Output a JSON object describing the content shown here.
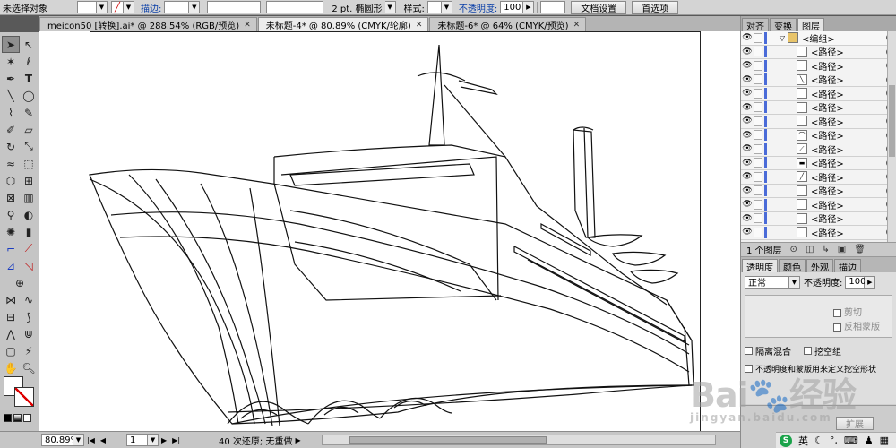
{
  "control_bar": {
    "selection_status": "未选择对象",
    "stroke_label": "描边:",
    "stroke_weight": "2 pt. 椭圆形",
    "style_label": "样式:",
    "opacity_label": "不透明度:",
    "opacity_value": "100",
    "doc_setup_button": "文档设置",
    "preferences_button": "首选项"
  },
  "tabs": [
    {
      "label": "meicon50 [转换].ai* @ 288.54% (RGB/预览)",
      "close": "✕"
    },
    {
      "label": "未标题-4* @ 80.89% (CMYK/轮廓)",
      "close": "✕"
    },
    {
      "label": "未标题-6* @ 64% (CMYK/预览)",
      "close": "✕"
    }
  ],
  "status": {
    "zoom": "80.89%",
    "page": "1",
    "undo": "40 次还原; 无重做"
  },
  "panels": {
    "top_tabs": [
      "对齐",
      "变换",
      "图层"
    ],
    "layers": {
      "group": "<编组>",
      "items": [
        "<路径>",
        "<路径>",
        "<路径>",
        "<路径>",
        "<路径>",
        "<路径>",
        "<路径>",
        "<路径>",
        "<路径>",
        "<路径>",
        "<路径>",
        "<路径>",
        "<路径>",
        "<路径>"
      ],
      "footer_count": "1 个图层"
    },
    "transparency_tabs": [
      "透明度",
      "颜色",
      "外观",
      "描边"
    ],
    "blend_mode": "正常",
    "opacity_label": "不透明度:",
    "opacity_value": "100",
    "clip_label": "剪切",
    "invert_mask_label": "反相蒙版",
    "isolate_blend": "隔离混合",
    "knockout_group": "挖空组",
    "opacity_mask_text": "不透明度和蒙版用来定义挖空形状",
    "expand_label": "扩展"
  },
  "ime": {
    "lang": "英"
  },
  "colors": {
    "ui_gray": "#c5c5c5",
    "canvas": "#ffffff",
    "layer_blue": "#4a6bd8"
  }
}
